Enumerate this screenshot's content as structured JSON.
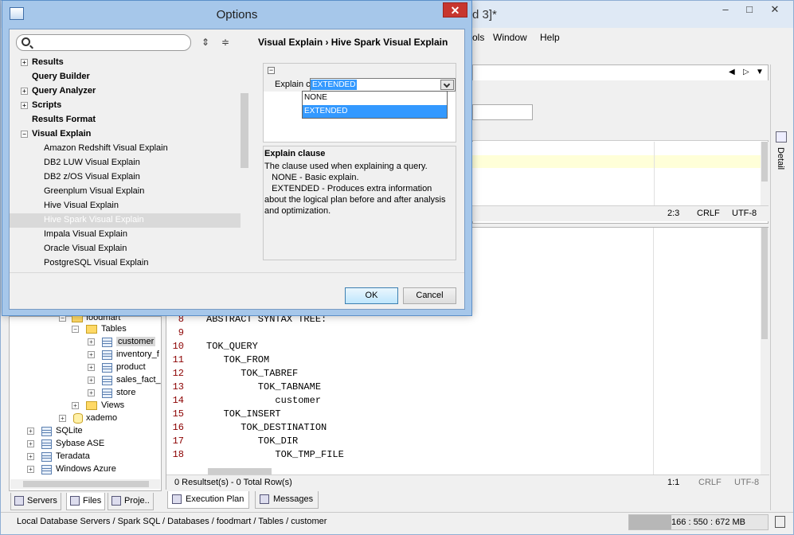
{
  "app": {
    "title": "d 3]*",
    "menu": [
      "ols",
      "Window",
      "Help"
    ],
    "window_buttons": [
      "–",
      "□",
      "✕"
    ],
    "detail_label": "Detail",
    "top_status": {
      "pos": "2:3",
      "eol": "CRLF",
      "enc": "UTF-8"
    },
    "bottom_status": {
      "results": "0 Resultset(s) - 0 Total Row(s)",
      "pos": "1:1",
      "eol": "CRLF",
      "enc": "UTF-8"
    },
    "bottom_tabs": [
      "Execution Plan",
      "Messages"
    ],
    "left_tabs": [
      "Servers",
      "Files",
      "Proje.."
    ],
    "status_path": "Local Database Servers / Spark SQL / Databases / foodmart / Tables / customer",
    "memory": {
      "text": "166 : 550 : 672 MB",
      "fraction": 0.3
    },
    "code_lines": [
      {
        "n": "7",
        "text": ""
      },
      {
        "n": "8",
        "text": "ABSTRACT SYNTAX TREE:"
      },
      {
        "n": "9",
        "text": ""
      },
      {
        "n": "10",
        "text": "TOK_QUERY"
      },
      {
        "n": "11",
        "text": "   TOK_FROM"
      },
      {
        "n": "12",
        "text": "      TOK_TABREF"
      },
      {
        "n": "13",
        "text": "         TOK_TABNAME"
      },
      {
        "n": "14",
        "text": "            customer"
      },
      {
        "n": "15",
        "text": "   TOK_INSERT"
      },
      {
        "n": "16",
        "text": "      TOK_DESTINATION"
      },
      {
        "n": "17",
        "text": "         TOK_DIR"
      },
      {
        "n": "18",
        "text": "            TOK_TMP_FILE"
      }
    ],
    "tree": {
      "foodmart": "foodmart",
      "tables": "Tables",
      "table_items": [
        "customer",
        "inventory_f",
        "product",
        "sales_fact_",
        "store"
      ],
      "views": "Views",
      "xademo": "xademo",
      "servers": [
        "SQLite",
        "Sybase ASE",
        "Teradata",
        "Windows Azure"
      ]
    }
  },
  "dialog": {
    "title": "Options",
    "close": "✕",
    "search_placeholder": "",
    "breadcrumb": "Visual Explain  ›  Hive Spark Visual Explain",
    "nav_items": [
      {
        "label": "Results",
        "bold": true,
        "exp": "+"
      },
      {
        "label": "Query Builder",
        "bold": true,
        "exp": ""
      },
      {
        "label": "Query Analyzer",
        "bold": true,
        "exp": "+"
      },
      {
        "label": "Scripts",
        "bold": true,
        "exp": "+"
      },
      {
        "label": "Results Format",
        "bold": true,
        "exp": ""
      },
      {
        "label": "Visual Explain",
        "bold": true,
        "exp": "−"
      },
      {
        "label": "Amazon Redshift Visual Explain",
        "bold": false
      },
      {
        "label": "DB2 LUW Visual Explain",
        "bold": false
      },
      {
        "label": "DB2 z/OS Visual Explain",
        "bold": false
      },
      {
        "label": "Greenplum Visual Explain",
        "bold": false
      },
      {
        "label": "Hive Visual Explain",
        "bold": false
      },
      {
        "label": "Hive Spark Visual Explain",
        "bold": false,
        "selected": true
      },
      {
        "label": "Impala Visual Explain",
        "bold": false
      },
      {
        "label": "Oracle Visual Explain",
        "bold": false
      },
      {
        "label": "PostgreSQL Visual Explain",
        "bold": false
      }
    ],
    "property": {
      "name": "Explain clause",
      "value": "EXTENDED",
      "options": [
        "NONE",
        "EXTENDED"
      ],
      "selected_option": "EXTENDED"
    },
    "description": {
      "title": "Explain clause",
      "lines": [
        "The clause used when explaining a query.",
        "   NONE - Basic explain.",
        "   EXTENDED - Produces extra information about the logical plan before and after analysis and optimization."
      ]
    },
    "buttons": {
      "ok": "OK",
      "cancel": "Cancel"
    }
  }
}
